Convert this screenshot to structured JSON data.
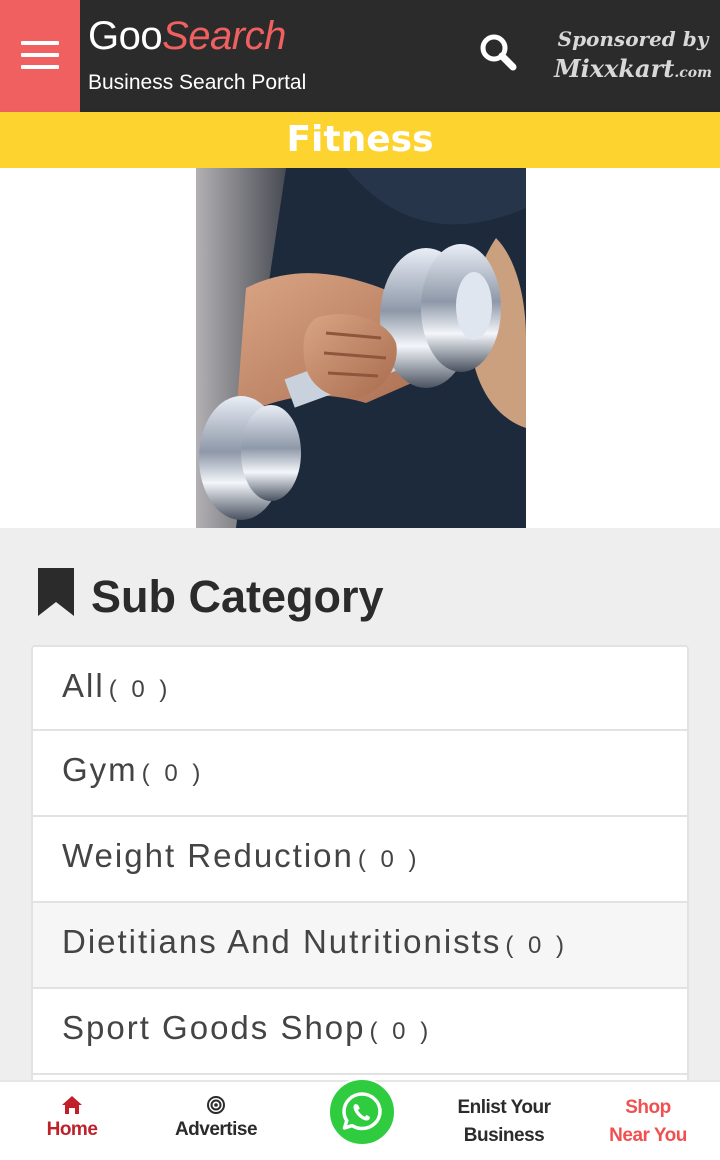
{
  "header": {
    "brand_part1": "Goo",
    "brand_part2": "Search",
    "tagline": "Business Search Portal",
    "sponsor_line1": "Sponsored by",
    "sponsor_line2": "Mixxkart",
    "sponsor_suffix": ".com"
  },
  "category_title": "Fitness",
  "subcategory": {
    "heading": "Sub Category",
    "items": [
      {
        "label": "All",
        "count": "( 0 )"
      },
      {
        "label": "Gym",
        "count": "( 0 )"
      },
      {
        "label": "Weight Reduction",
        "count": "( 0 )"
      },
      {
        "label": "Dietitians And Nutritionists",
        "count": "( 0 )"
      },
      {
        "label": "Sport Goods Shop",
        "count": "( 0 )"
      }
    ]
  },
  "bottom_nav": {
    "home": "Home",
    "advertise": "Advertise",
    "enlist_line1": "Enlist Your",
    "enlist_line2": "Business",
    "shop_line1": "Shop",
    "shop_line2": "Near You"
  },
  "colors": {
    "header_bg": "#2b2b2b",
    "accent_red": "#f06060",
    "title_yellow": "#fdd42f",
    "nav_red": "#c0202a",
    "shop_red": "#f05050",
    "whatsapp_green": "#2fcc40"
  },
  "icons": {
    "menu": "hamburger-icon",
    "search": "search-icon",
    "subcategory": "bookmark-icon",
    "home": "home-icon",
    "advertise": "bullseye-icon",
    "whatsapp": "whatsapp-icon"
  }
}
